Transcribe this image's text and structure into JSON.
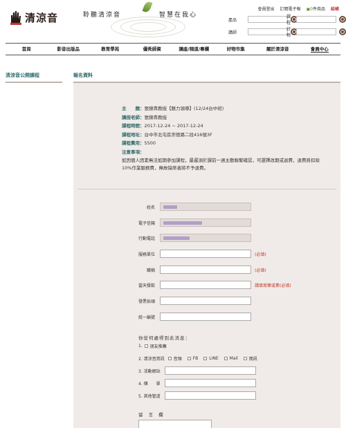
{
  "header": {
    "logo_text": "清涼音",
    "slogan_left": "聆聽清涼音",
    "slogan_right": "智慧在我心",
    "toplinks": {
      "logout": "會員登出",
      "subscribe": "訂閱電子報",
      "cart_prefix": "0",
      "cart_label": "件商品",
      "checkout": "結帳"
    },
    "search": {
      "product_label": "產品",
      "course_label": "課程",
      "speech_label": "講師",
      "goods_label": "好物"
    }
  },
  "nav": {
    "items": [
      "首頁",
      "影音出版品",
      "教育學苑",
      "優秀師資",
      "講座/頻道/專欄",
      "好物市集",
      "關於清涼音",
      "會員中心"
    ]
  },
  "sidebar": {
    "title": "清涼音公開課程"
  },
  "main": {
    "title": "報名資料",
    "course": {
      "topic_label": "主　　題：",
      "topic": "張錦貴教授【魅力領導】(12/24台中班)",
      "teacher_label": "講授老師：",
      "teacher": "張錦貴教授",
      "time_label": "課程時間：",
      "time": "2017-12-24 ~ 2017-12-24",
      "address_label": "課程地址：",
      "address": "台中市北屯區崇德路二段416號3F",
      "fee_label": "課程費用：",
      "fee": "5500",
      "notice_label": "注意事項：",
      "notice": "如因個人因素無法如期參加課程，最遲須於課前一週主動聯繫確認，可選擇改期或退費，退費將扣除10%作業服務費，無故缺席者將不予退費。"
    },
    "form": {
      "name_label": "姓名",
      "email_label": "電子信箱",
      "mobile_label": "行動電話",
      "company_label": "服務單位",
      "company_req": "(必填)",
      "title_label": "職稱",
      "title_req": "(必填)",
      "diet_label": "當天餐飲",
      "diet_req": "請填寫葷或素(必填)",
      "invoice_label": "發票抬頭",
      "taxid_label": "統一編號"
    },
    "source": {
      "title": "你從何處得到此消息：",
      "opt1": "1.",
      "opt1_label": "朋友推薦",
      "opt2": "2. 清涼音資訊",
      "opt2_items": [
        "音頻",
        "FB",
        "LINE",
        "Mail",
        "簡訊"
      ],
      "opt3": "3. 活動網站",
      "opt4": "4. 傳　　單",
      "opt5": "5. 其他管道"
    },
    "message_label": "留 言 欄"
  }
}
